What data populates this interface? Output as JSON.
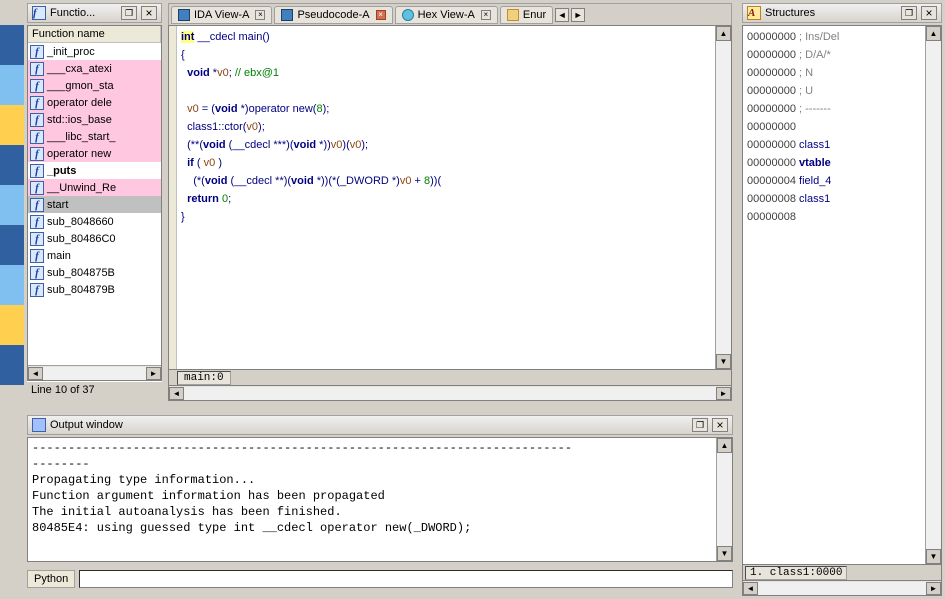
{
  "func_panel": {
    "title": "Functio...",
    "column": "Function name",
    "status": "Line 10 of 37",
    "items": [
      {
        "label": "_init_proc",
        "pink": false,
        "sel": false,
        "bold": false
      },
      {
        "label": "___cxa_atexi",
        "pink": true,
        "sel": false,
        "bold": false
      },
      {
        "label": "___gmon_sta",
        "pink": true,
        "sel": false,
        "bold": false
      },
      {
        "label": "operator dele",
        "pink": true,
        "sel": false,
        "bold": false
      },
      {
        "label": "std::ios_base",
        "pink": true,
        "sel": false,
        "bold": false
      },
      {
        "label": "___libc_start_",
        "pink": true,
        "sel": false,
        "bold": false
      },
      {
        "label": "operator new",
        "pink": true,
        "sel": false,
        "bold": false
      },
      {
        "label": "_puts",
        "pink": false,
        "sel": false,
        "bold": true
      },
      {
        "label": "__Unwind_Re",
        "pink": true,
        "sel": false,
        "bold": false
      },
      {
        "label": "start",
        "pink": false,
        "sel": true,
        "bold": false
      },
      {
        "label": "sub_8048660",
        "pink": false,
        "sel": false,
        "bold": false
      },
      {
        "label": "sub_80486C0",
        "pink": false,
        "sel": false,
        "bold": false
      },
      {
        "label": "main",
        "pink": false,
        "sel": false,
        "bold": false
      },
      {
        "label": "sub_804875B",
        "pink": false,
        "sel": false,
        "bold": false
      },
      {
        "label": "sub_804879B",
        "pink": false,
        "sel": false,
        "bold": false
      }
    ]
  },
  "tabs": {
    "items": [
      {
        "label": "IDA View-A",
        "active": false,
        "close": "grey",
        "icon": "ida"
      },
      {
        "label": "Pseudocode-A",
        "active": true,
        "close": "red",
        "icon": "ida"
      },
      {
        "label": "Hex View-A",
        "active": false,
        "close": "grey",
        "icon": "hex"
      },
      {
        "label": "Enur",
        "active": false,
        "close": "none",
        "icon": "enum"
      }
    ]
  },
  "code": {
    "lines": [
      {
        "t": "ret",
        "txt": "int"
      },
      {
        "t": "plain",
        "txt": " __cdecl main()"
      },
      {
        "br": true
      },
      {
        "t": "nm",
        "txt": "{"
      },
      {
        "br": true
      },
      {
        "t": "plain",
        "txt": "  "
      },
      {
        "t": "ty",
        "txt": "void"
      },
      {
        "t": "plain",
        "txt": " *"
      },
      {
        "t": "id",
        "txt": "v0"
      },
      {
        "t": "plain",
        "txt": "; "
      },
      {
        "t": "cm",
        "txt": "// ebx@1"
      },
      {
        "br": true
      },
      {
        "br": true
      },
      {
        "t": "plain",
        "txt": "  "
      },
      {
        "t": "id",
        "txt": "v0"
      },
      {
        "t": "plain",
        "txt": " = ("
      },
      {
        "t": "ty",
        "txt": "void"
      },
      {
        "t": "plain",
        "txt": " *)operator new("
      },
      {
        "t": "num",
        "txt": "8"
      },
      {
        "t": "plain",
        "txt": ");"
      },
      {
        "br": true
      },
      {
        "t": "plain",
        "txt": "  class1::ctor("
      },
      {
        "t": "id",
        "txt": "v0"
      },
      {
        "t": "plain",
        "txt": ");"
      },
      {
        "br": true
      },
      {
        "t": "plain",
        "txt": "  (**("
      },
      {
        "t": "ty",
        "txt": "void"
      },
      {
        "t": "plain",
        "txt": " (__cdecl ***)("
      },
      {
        "t": "ty",
        "txt": "void"
      },
      {
        "t": "plain",
        "txt": " *))"
      },
      {
        "t": "id",
        "txt": "v0"
      },
      {
        "t": "plain",
        "txt": ")("
      },
      {
        "t": "id",
        "txt": "v0"
      },
      {
        "t": "plain",
        "txt": ");"
      },
      {
        "br": true
      },
      {
        "t": "plain",
        "txt": "  "
      },
      {
        "t": "kw",
        "txt": "if"
      },
      {
        "t": "plain",
        "txt": " ( "
      },
      {
        "t": "id",
        "txt": "v0"
      },
      {
        "t": "plain",
        "txt": " )"
      },
      {
        "br": true
      },
      {
        "t": "plain",
        "txt": "    (*("
      },
      {
        "t": "ty",
        "txt": "void"
      },
      {
        "t": "plain",
        "txt": " (__cdecl **)("
      },
      {
        "t": "ty",
        "txt": "void"
      },
      {
        "t": "plain",
        "txt": " *))(*(_DWORD *)"
      },
      {
        "t": "id",
        "txt": "v0"
      },
      {
        "t": "plain",
        "txt": " + "
      },
      {
        "t": "num",
        "txt": "8"
      },
      {
        "t": "plain",
        "txt": "))("
      },
      {
        "br": true
      },
      {
        "t": "plain",
        "txt": "  "
      },
      {
        "t": "kw",
        "txt": "return"
      },
      {
        "t": "plain",
        "txt": " "
      },
      {
        "t": "num",
        "txt": "0"
      },
      {
        "t": "plain",
        "txt": ";"
      },
      {
        "br": true
      },
      {
        "t": "nm",
        "txt": "}"
      }
    ],
    "offset": "main:0"
  },
  "struct_panel": {
    "title": "Structures",
    "status": "1. class1:0000",
    "lines": [
      {
        "a": "00000000",
        "c": " ; Ins/Del"
      },
      {
        "a": "00000000",
        "c": " ; D/A/*"
      },
      {
        "a": "00000000",
        "c": " ; N"
      },
      {
        "a": "00000000",
        "c": " ; U"
      },
      {
        "a": "00000000",
        "c": " ; -------"
      },
      {
        "a": "00000000",
        "c": ""
      },
      {
        "a": "00000000",
        "b": " class1"
      },
      {
        "a": "00000000",
        "bl": " vtable"
      },
      {
        "a": "00000004",
        "b": " field_4"
      },
      {
        "a": "00000008",
        "b": " class1"
      },
      {
        "a": "00000008",
        "c": ""
      }
    ]
  },
  "output": {
    "title": "Output window",
    "lines": [
      "--------",
      "Propagating type information...",
      "Function argument information has been propagated",
      "The initial autoanalysis has been finished.",
      "80485E4: using guessed type int __cdecl operator new(_DWORD);"
    ]
  },
  "python": {
    "label": "Python",
    "value": ""
  },
  "thinstrip": [
    "#3060a0",
    "#80c0f0",
    "#ffd050",
    "#3060a0",
    "#80c0f0",
    "#3060a0",
    "#80c0f0",
    "#ffd050",
    "#3060a0"
  ]
}
